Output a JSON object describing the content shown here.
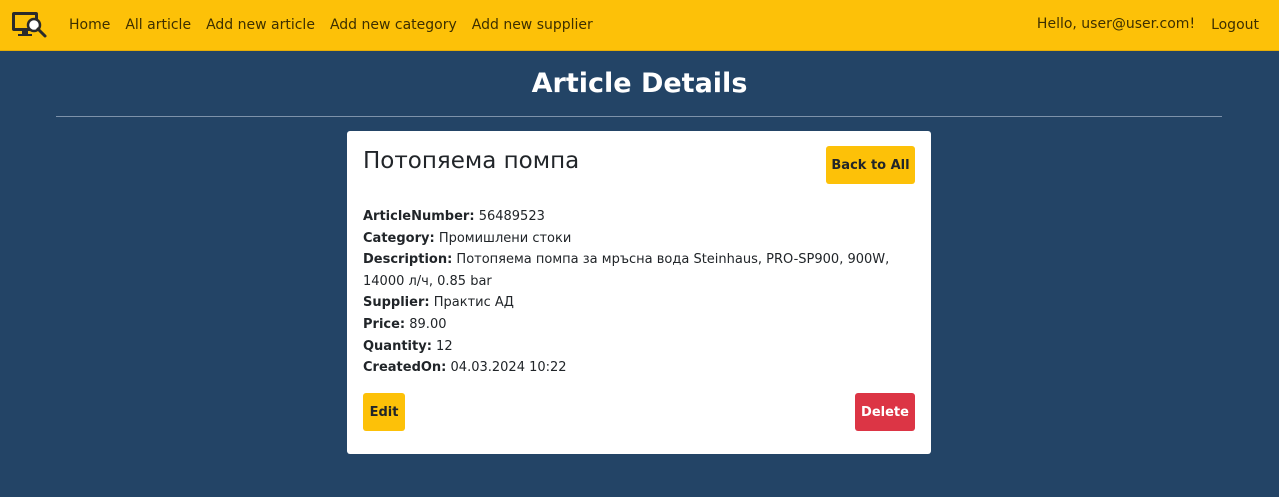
{
  "nav": {
    "links": [
      "Home",
      "All article",
      "Add new article",
      "Add new category",
      "Add new supplier"
    ],
    "greeting": "Hello, user@user.com!",
    "logout": "Logout"
  },
  "page": {
    "title": "Article Details"
  },
  "article": {
    "name": "Потопяема помпа",
    "back_label": "Back to All",
    "fields": [
      {
        "label": "ArticleNumber:",
        "value": "56489523"
      },
      {
        "label": "Category:",
        "value": "Промишлени стоки"
      },
      {
        "label": "Description:",
        "value": "Потопяема помпа за мръсна вода Steinhaus, PRO-SP900, 900W, 14000 л/ч, 0.85 bar"
      },
      {
        "label": "Supplier:",
        "value": "Практис АД"
      },
      {
        "label": "Price:",
        "value": "89.00"
      },
      {
        "label": "Quantity:",
        "value": "12"
      },
      {
        "label": "CreatedOn:",
        "value": "04.03.2024 10:22"
      }
    ],
    "edit_label": "Edit",
    "delete_label": "Delete"
  },
  "colors": {
    "navbar": "#fdc108",
    "background": "#234466",
    "danger": "#dc3545"
  },
  "icons": {
    "logo": "monitor-search-logo-icon"
  }
}
